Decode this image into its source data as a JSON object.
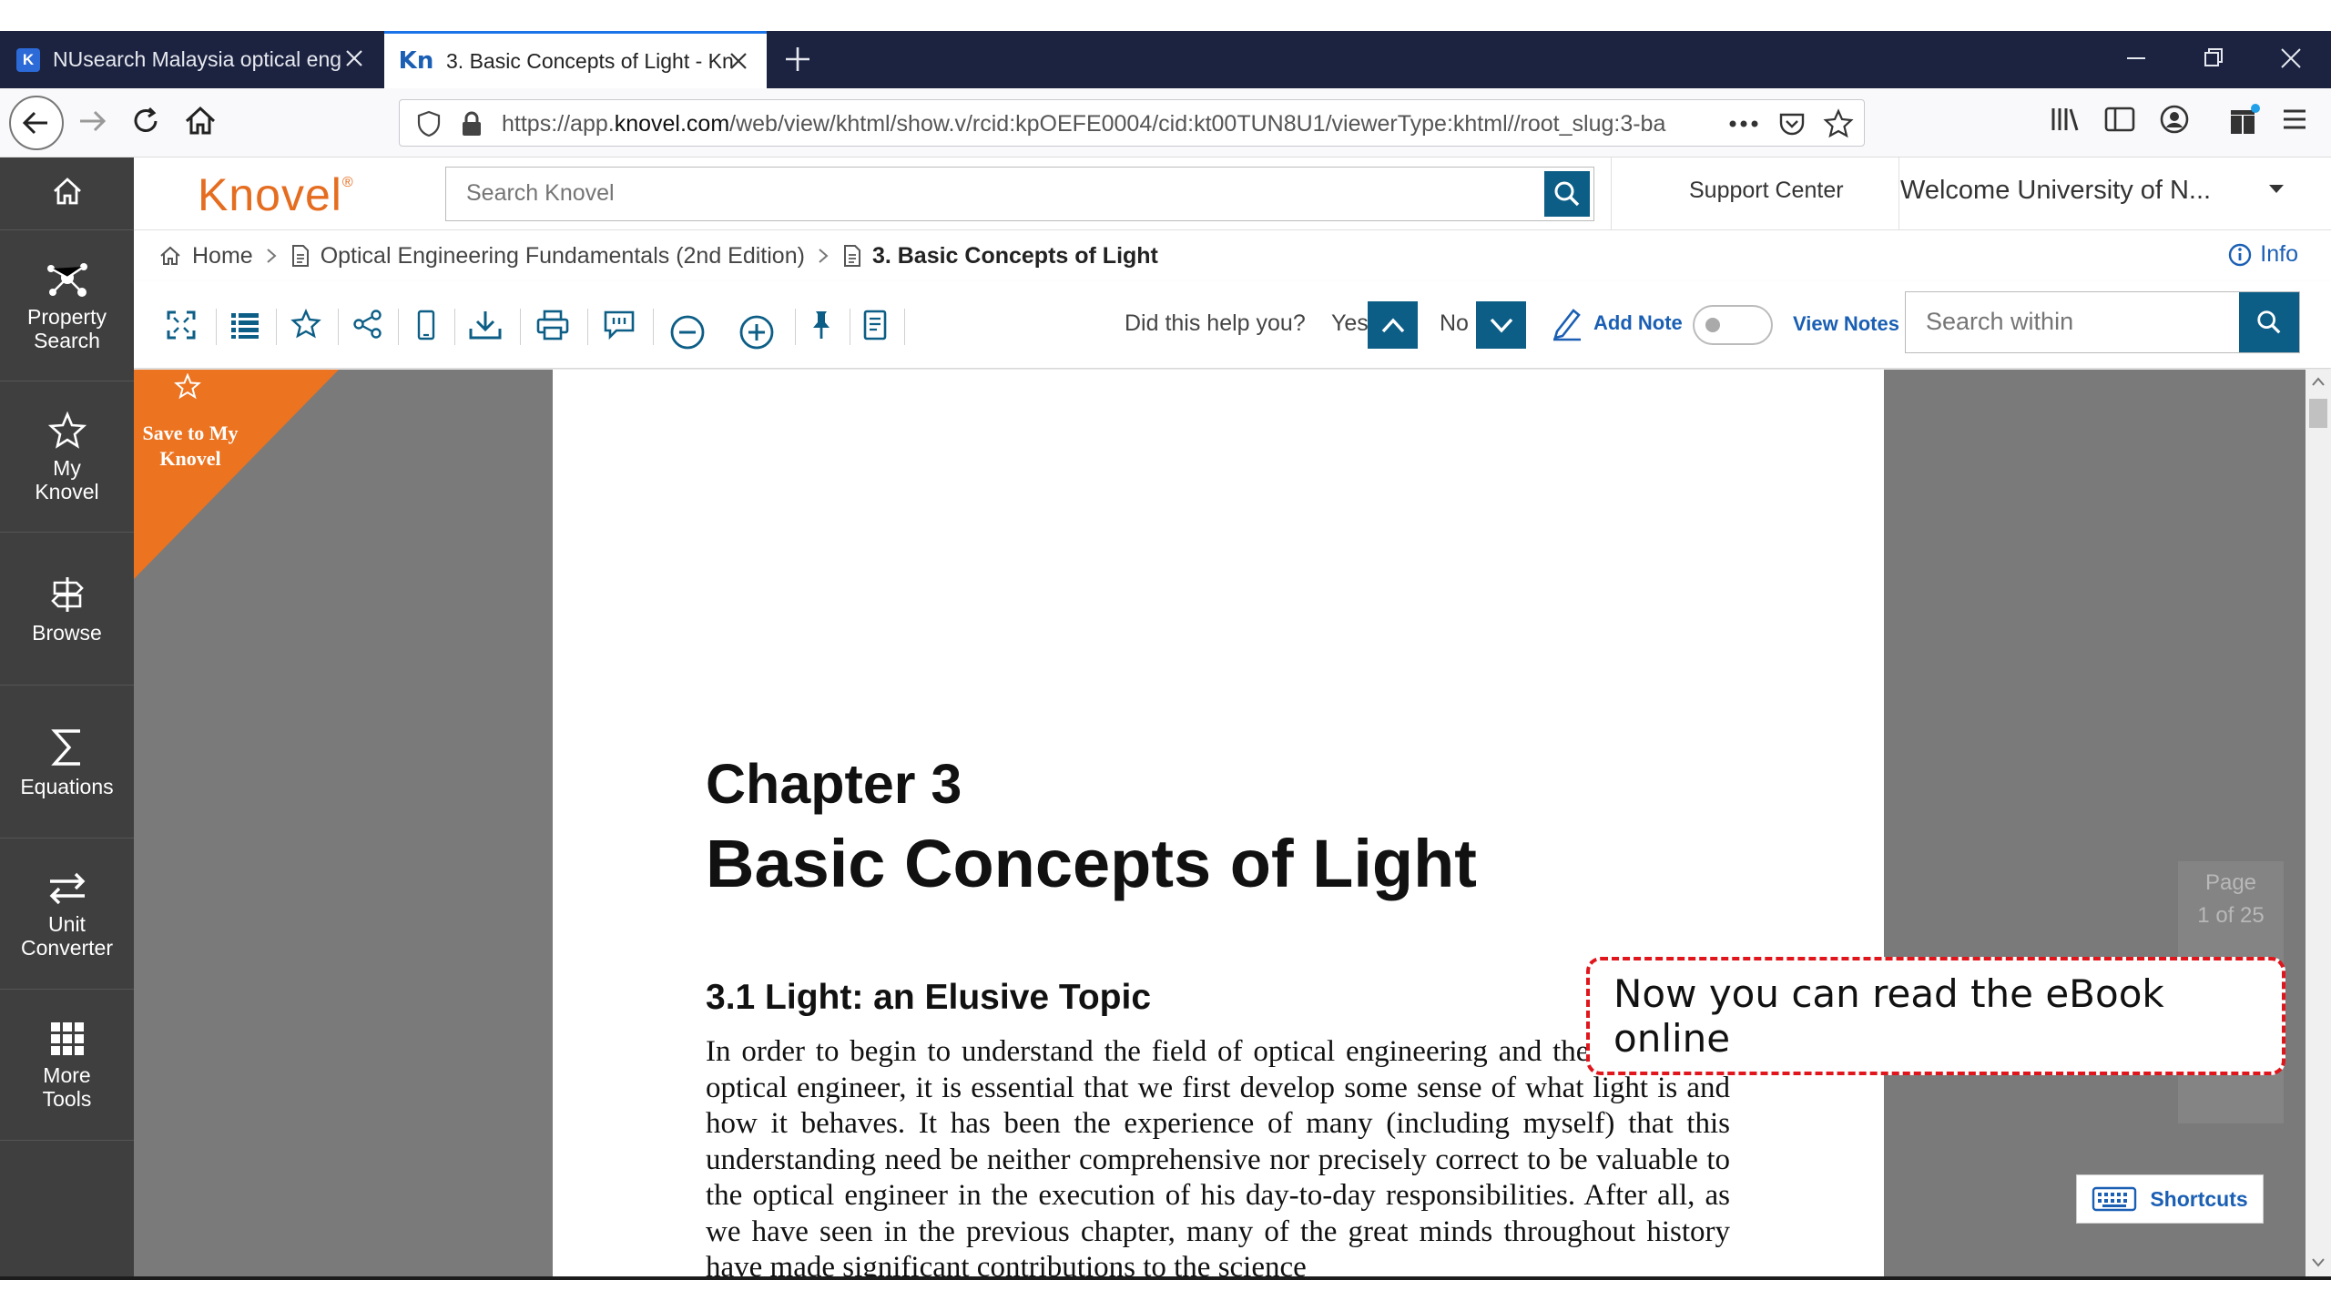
{
  "browser": {
    "tabs": [
      {
        "title": "NUsearch Malaysia optical eng",
        "favicon": "K",
        "active": false
      },
      {
        "title": "3. Basic Concepts of Light - Kn",
        "favicon": "Kn",
        "active": true
      }
    ],
    "url_prefix": "https://app.",
    "url_domain": "knovel.com",
    "url_rest": "/web/view/khtml/show.v/rcid:kpOEFE0004/cid:kt00TUN8U1/viewerType:khtml//root_slug:3-ba"
  },
  "sidebar": {
    "items": [
      {
        "label": "",
        "icon": "home-icon"
      },
      {
        "label": "Property Search",
        "icon": "molecule-icon"
      },
      {
        "label": "My Knovel",
        "icon": "star-icon"
      },
      {
        "label": "Browse",
        "icon": "signpost-icon"
      },
      {
        "label": "Equations",
        "icon": "sigma-icon"
      },
      {
        "label": "Unit Converter",
        "icon": "swap-arrows-icon"
      },
      {
        "label": "More Tools",
        "icon": "grid-icon"
      }
    ]
  },
  "header": {
    "logo": "Knovel",
    "logo_mark": "®",
    "search_placeholder": "Search Knovel",
    "support": "Support Center",
    "welcome": "Welcome University of N..."
  },
  "breadcrumb": {
    "home": "Home",
    "book": "Optical Engineering Fundamentals (2nd Edition)",
    "chapter": "3. Basic Concepts of Light",
    "info": "Info"
  },
  "toolbar": {
    "help_question": "Did this help you?",
    "yes": "Yes",
    "no": "No",
    "add_note": "Add Note",
    "view_notes": "View Notes",
    "search_within_placeholder": "Search within"
  },
  "viewer": {
    "save_label": "Save to My Knovel",
    "page_label": "Page",
    "page_count": "1 of 25",
    "shortcuts": "Shortcuts"
  },
  "document": {
    "chapter_number": "Chapter 3",
    "chapter_title": "Basic Concepts of Light",
    "section_title": "3.1 Light: an Elusive Topic",
    "body": "In order to begin to understand the field of optical engineering and the role of the optical engineer, it is essential that we first develop some sense of what light is and how it behaves. It has been the experience of many (including myself) that this understanding need be neither comprehensive nor precisely correct to be valuable to the optical engineer in the execution of his day-to-day responsibilities. After all, as we have seen in the previous chapter, many of the great minds throughout history have made significant contributions to the science"
  },
  "callout": {
    "text": "Now you can read the eBook online"
  },
  "colors": {
    "accent": "#0c5e86",
    "brand_orange": "#e56d20",
    "callout_border": "#e0161c",
    "tabbar": "#1c2340",
    "sidebar": "#3f3f3f"
  }
}
